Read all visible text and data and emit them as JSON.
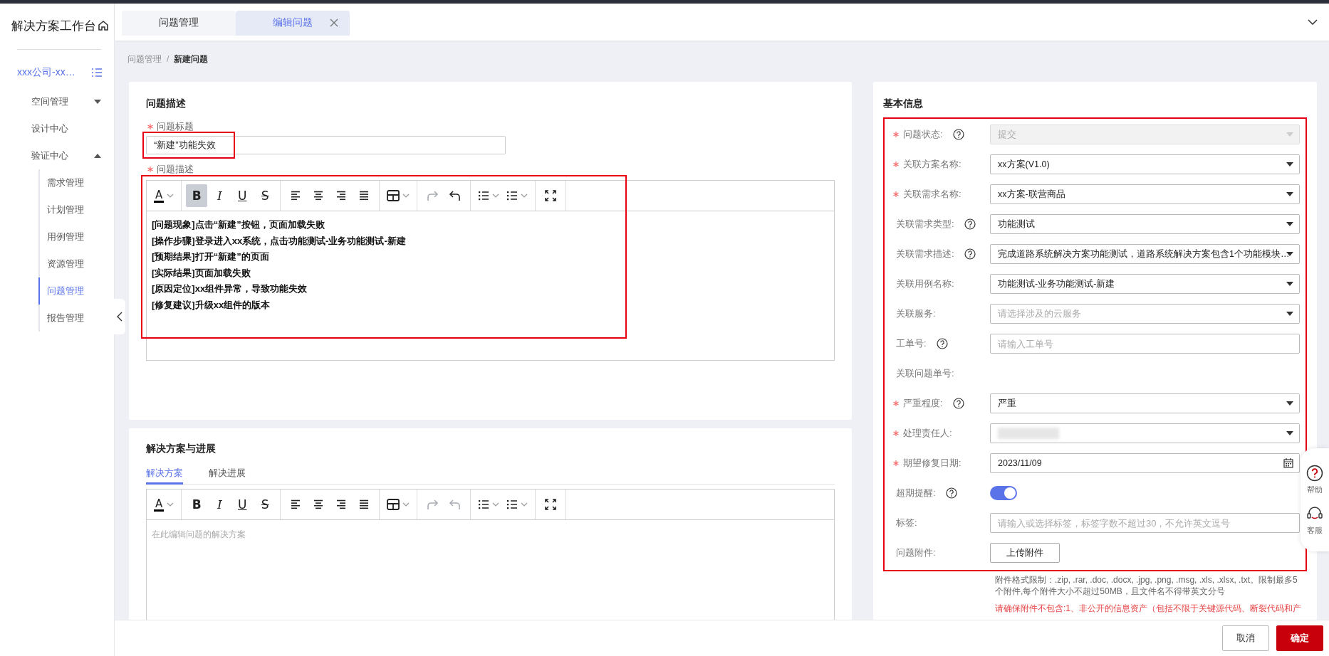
{
  "sidebar": {
    "title": "解决方案工作台",
    "project": "xxx公司-xx…",
    "items": [
      {
        "label": "空间管理",
        "kind": "group",
        "expanded": false
      },
      {
        "label": "设计中心",
        "kind": "link"
      },
      {
        "label": "验证中心",
        "kind": "group",
        "expanded": true,
        "children": [
          {
            "label": "需求管理",
            "selected": false
          },
          {
            "label": "计划管理",
            "selected": false
          },
          {
            "label": "用例管理",
            "selected": false
          },
          {
            "label": "资源管理",
            "selected": false
          },
          {
            "label": "问题管理",
            "selected": true
          },
          {
            "label": "报告管理",
            "selected": false
          }
        ]
      }
    ]
  },
  "tabs": [
    {
      "label": "问题管理",
      "selected": false,
      "closable": false
    },
    {
      "label": "编辑问题",
      "selected": true,
      "closable": true
    }
  ],
  "breadcrumb": {
    "items": [
      "问题管理",
      "新建问题"
    ],
    "separator": "/"
  },
  "description": {
    "title": "问题描述",
    "title_field": {
      "label": "问题标题",
      "required": true,
      "value": "“新建”功能失效",
      "highlighted": true
    },
    "editor": {
      "label": "问题描述",
      "required": true,
      "highlighted": true,
      "toolbar": [
        {
          "tools": [
            {
              "kind": "font-color",
              "glyph": "A",
              "menu": true
            }
          ]
        },
        {
          "tools": [
            {
              "kind": "bold",
              "glyph": "B",
              "active": true
            },
            {
              "kind": "italic",
              "glyph": "I",
              "active": false
            },
            {
              "kind": "underline",
              "glyph": "U",
              "active": false
            },
            {
              "kind": "strike",
              "glyph": "S",
              "active": false
            }
          ]
        },
        {
          "tools": [
            {
              "kind": "align-left"
            },
            {
              "kind": "align-center"
            },
            {
              "kind": "align-right"
            },
            {
              "kind": "justify"
            }
          ]
        },
        {
          "tools": [
            {
              "kind": "table",
              "menu": true
            }
          ]
        },
        {
          "tools": [
            {
              "kind": "redo",
              "disabled": true
            },
            {
              "kind": "undo",
              "disabled": false
            }
          ]
        },
        {
          "tools": [
            {
              "kind": "bullet-list",
              "menu": true
            },
            {
              "kind": "number-list",
              "menu": true
            }
          ]
        },
        {
          "tools": [
            {
              "kind": "fullscreen"
            }
          ]
        }
      ],
      "lines": [
        "[问题现象]点击“新建”按钮，页面加载失败",
        "[操作步骤]登录进入xx系统，点击功能测试-业务功能测试-新建",
        "[预期结果]打开“新建”的页面",
        "[实际结果]页面加载失败",
        "[原因定位]xx组件异常，导致功能失效",
        "[修复建议]升级xx组件的版本"
      ]
    }
  },
  "solution": {
    "title": "解决方案与进展",
    "tabs": [
      {
        "label": "解决方案",
        "selected": true
      },
      {
        "label": "解决进展",
        "selected": false
      }
    ],
    "editor": {
      "placeholder": "在此编辑问题的解决方案",
      "toolbar": [
        {
          "tools": [
            {
              "kind": "font-color",
              "glyph": "A",
              "menu": true
            }
          ]
        },
        {
          "tools": [
            {
              "kind": "bold",
              "glyph": "B",
              "active": false
            },
            {
              "kind": "italic",
              "glyph": "I",
              "active": false
            },
            {
              "kind": "underline",
              "glyph": "U",
              "active": false
            },
            {
              "kind": "strike",
              "glyph": "S",
              "active": false
            }
          ]
        },
        {
          "tools": [
            {
              "kind": "align-left"
            },
            {
              "kind": "align-center"
            },
            {
              "kind": "align-right"
            },
            {
              "kind": "justify"
            }
          ]
        },
        {
          "tools": [
            {
              "kind": "table",
              "menu": true
            }
          ]
        },
        {
          "tools": [
            {
              "kind": "redo",
              "disabled": true
            },
            {
              "kind": "undo",
              "disabled": true
            }
          ]
        },
        {
          "tools": [
            {
              "kind": "bullet-list",
              "menu": true
            },
            {
              "kind": "number-list",
              "menu": true
            }
          ]
        },
        {
          "tools": [
            {
              "kind": "fullscreen"
            }
          ]
        }
      ]
    }
  },
  "basic_info": {
    "title": "基本信息",
    "highlighted": true,
    "fields": [
      {
        "label": "问题状态:",
        "required": true,
        "help": true,
        "kind": "select",
        "value": "提交",
        "disabled": true
      },
      {
        "label": "关联方案名称:",
        "required": true,
        "help": false,
        "kind": "select",
        "value": "xx方案(V1.0)",
        "disabled": false
      },
      {
        "label": "关联需求名称:",
        "required": true,
        "help": false,
        "kind": "select",
        "value": "xx方案-联营商品",
        "disabled": false
      },
      {
        "label": "关联需求类型:",
        "required": false,
        "help": true,
        "kind": "select",
        "value": "功能测试",
        "disabled": false
      },
      {
        "label": "关联需求描述:",
        "required": false,
        "help": true,
        "kind": "select",
        "value": "完成道路系统解决方案功能测试，道路系统解决方案包含1个功能模块…",
        "disabled": false
      },
      {
        "label": "关联用例名称:",
        "required": false,
        "help": false,
        "kind": "select",
        "value": "功能测试-业务功能测试-新建",
        "disabled": false
      },
      {
        "label": "关联服务:",
        "required": false,
        "help": false,
        "kind": "select",
        "placeholder": "请选择涉及的云服务",
        "disabled": false
      },
      {
        "label": "工单号:",
        "required": false,
        "help": true,
        "kind": "text",
        "placeholder": "请输入工单号"
      },
      {
        "label": "关联问题单号:",
        "required": false,
        "help": false,
        "kind": "static"
      },
      {
        "label": "严重程度:",
        "required": true,
        "help": true,
        "kind": "select",
        "value": "严重",
        "disabled": false
      },
      {
        "label": "处理责任人:",
        "required": true,
        "help": false,
        "kind": "select",
        "redacted": true,
        "disabled": false
      },
      {
        "label": "期望修复日期:",
        "required": true,
        "help": false,
        "kind": "date",
        "value": "2023/11/09"
      },
      {
        "label": "超期提醒:",
        "required": false,
        "help": true,
        "kind": "switch",
        "on": true
      },
      {
        "label": "标签:",
        "required": false,
        "help": false,
        "kind": "text",
        "placeholder": "请输入或选择标签，标签字数不超过30，不允许英文逗号"
      },
      {
        "label": "问题附件:",
        "required": false,
        "help": false,
        "kind": "button",
        "button": "上传附件"
      }
    ],
    "hint": "附件格式限制：.zip, .rar, .doc, .docx, .jpg, .png, .msg, .xls, .xlsx, .txt。限制最多5个附件,每个附件大小不超过50MB，且文件名不得带英文分号",
    "warning": "请确保附件不包含:1、非公开的信息资产（包括不限于关键源代码、断裂代码和产"
  },
  "footer": {
    "buttons": [
      {
        "label": "取消",
        "kind": "secondary"
      },
      {
        "label": "确定",
        "kind": "primary"
      }
    ]
  },
  "float_tools": [
    {
      "label": "帮助",
      "kind": "help"
    },
    {
      "label": "客服",
      "kind": "service"
    }
  ]
}
